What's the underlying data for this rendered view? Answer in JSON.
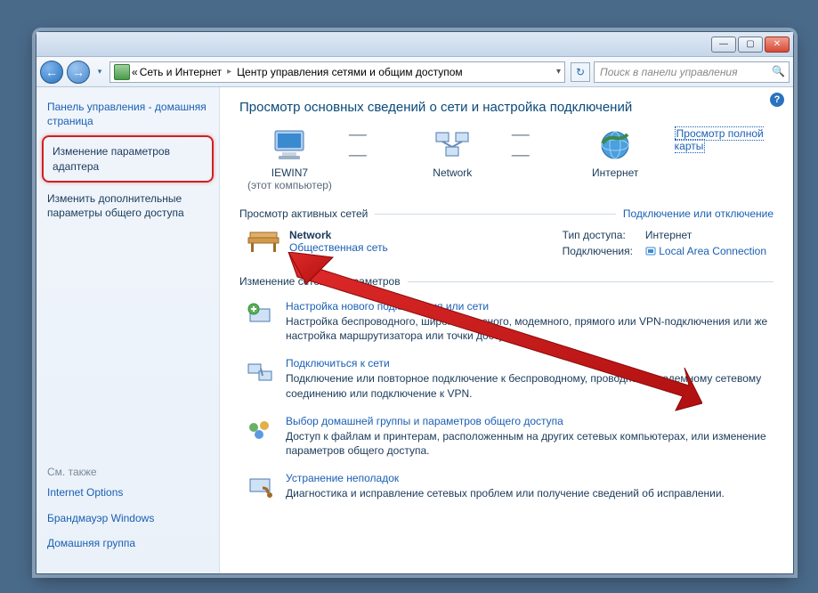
{
  "titlebar": {
    "minimize": "—",
    "maximize": "▢",
    "close": "✕"
  },
  "nav": {
    "back_glyph": "←",
    "fwd_glyph": "→",
    "drop_glyph": "▾"
  },
  "breadcrumb": {
    "prefix": "«",
    "part1": "Сеть и Интернет",
    "part2": "Центр управления сетями и общим доступом",
    "sep": "▸",
    "dropdown": "▾",
    "refresh": "↻"
  },
  "search": {
    "placeholder": "Поиск в панели управления",
    "icon": "🔍"
  },
  "help": {
    "glyph": "?"
  },
  "sidebar": {
    "home": "Панель управления - домашняя страница",
    "adapter": "Изменение параметров адаптера",
    "sharing": "Изменить дополнительные параметры общего доступа",
    "seealso_title": "См. также",
    "seealso": {
      "internet_options": "Internet Options",
      "firewall": "Брандмауэр Windows",
      "homegroup": "Домашняя группа"
    }
  },
  "main": {
    "heading": "Просмотр основных сведений о сети и настройка подключений",
    "map": {
      "this_pc_name": "IEWIN7",
      "this_pc_sub": "(этот компьютер)",
      "network_label": "Network",
      "internet_label": "Интернет",
      "full_map_link": "Просмотр полной карты"
    },
    "active_nets_title": "Просмотр активных сетей",
    "connect_toggle_link": "Подключение или отключение",
    "network": {
      "name": "Network",
      "type": "Общественная сеть",
      "access_label": "Тип доступа:",
      "access_value": "Интернет",
      "conn_label": "Подключения:",
      "conn_value": "Local Area Connection"
    },
    "change_settings_title": "Изменение сетевых параметров",
    "items": [
      {
        "title": "Настройка нового подключения или сети",
        "desc": "Настройка беспроводного, широкополосного, модемного, прямого или VPN-подключения или же настройка маршрутизатора или точки доступа.",
        "icon": "new-connection-icon"
      },
      {
        "title": "Подключиться к сети",
        "desc": "Подключение или повторное подключение к беспроводному, проводному, модемному сетевому соединению или подключение к VPN.",
        "icon": "connect-network-icon"
      },
      {
        "title": "Выбор домашней группы и параметров общего доступа",
        "desc": "Доступ к файлам и принтерам, расположенным на других сетевых компьютерах, или изменение параметров общего доступа.",
        "icon": "homegroup-icon"
      },
      {
        "title": "Устранение неполадок",
        "desc": "Диагностика и исправление сетевых проблем или получение сведений об исправлении.",
        "icon": "troubleshoot-icon"
      }
    ]
  }
}
